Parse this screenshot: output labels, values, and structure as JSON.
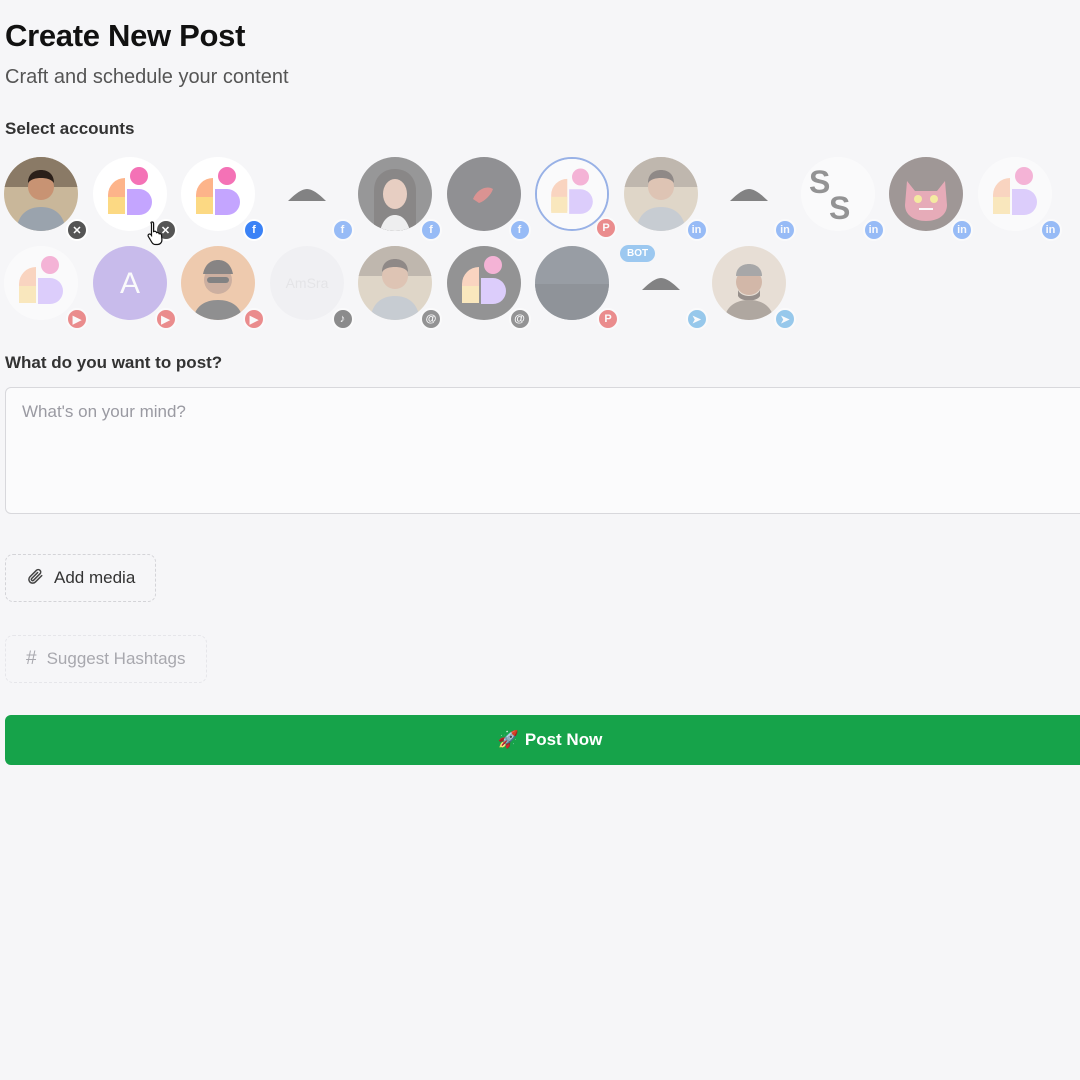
{
  "header": {
    "title": "Create New Post",
    "subtitle": "Craft and schedule your content"
  },
  "accounts_section": {
    "label": "Select accounts",
    "bot_badge": "BOT",
    "accounts": [
      {
        "avatar": "man-photo",
        "platform": "x",
        "selected": false
      },
      {
        "avatar": "app-logo",
        "platform": "x",
        "selected": false
      },
      {
        "avatar": "app-logo",
        "platform": "facebook",
        "selected": false
      },
      {
        "avatar": "mountain-placeholder",
        "platform": "facebook",
        "selected": false
      },
      {
        "avatar": "woman-photo",
        "platform": "facebook",
        "selected": false
      },
      {
        "avatar": "dark-abstract",
        "platform": "facebook",
        "selected": false
      },
      {
        "avatar": "app-logo",
        "platform": "pinterest",
        "selected": true
      },
      {
        "avatar": "man-photo",
        "platform": "linkedin",
        "selected": false
      },
      {
        "avatar": "mountain-placeholder",
        "platform": "linkedin",
        "selected": false
      },
      {
        "avatar": "ss-logo",
        "platform": "linkedin",
        "selected": false
      },
      {
        "avatar": "cat-mask",
        "platform": "linkedin",
        "selected": false
      },
      {
        "avatar": "app-logo",
        "platform": "linkedin",
        "selected": false
      },
      {
        "avatar": "app-logo",
        "platform": "youtube",
        "selected": false
      },
      {
        "avatar": "letter-a",
        "letter": "A",
        "platform": "youtube",
        "selected": false
      },
      {
        "avatar": "man-sunglasses",
        "platform": "youtube",
        "selected": false
      },
      {
        "avatar": "light-placeholder",
        "platform": "tiktok",
        "selected": false
      },
      {
        "avatar": "man-photo",
        "platform": "threads",
        "selected": false
      },
      {
        "avatar": "app-logo-dark",
        "platform": "threads",
        "selected": false
      },
      {
        "avatar": "dark-blue-photo",
        "platform": "pinterest",
        "selected": false
      },
      {
        "avatar": "mountain-placeholder",
        "platform": "telegram",
        "selected": false
      },
      {
        "avatar": "man-cap-photo",
        "platform": "telegram",
        "selected": false
      }
    ]
  },
  "composer": {
    "label": "What do you want to post?",
    "placeholder": "What's on your mind?",
    "value": ""
  },
  "actions": {
    "add_media": "Add media",
    "suggest_hashtags": "Suggest Hashtags",
    "post_now_emoji": "🚀",
    "post_now": "Post Now"
  },
  "colors": {
    "accent_green": "#16a34a",
    "selected_ring": "#3d6fd6"
  }
}
